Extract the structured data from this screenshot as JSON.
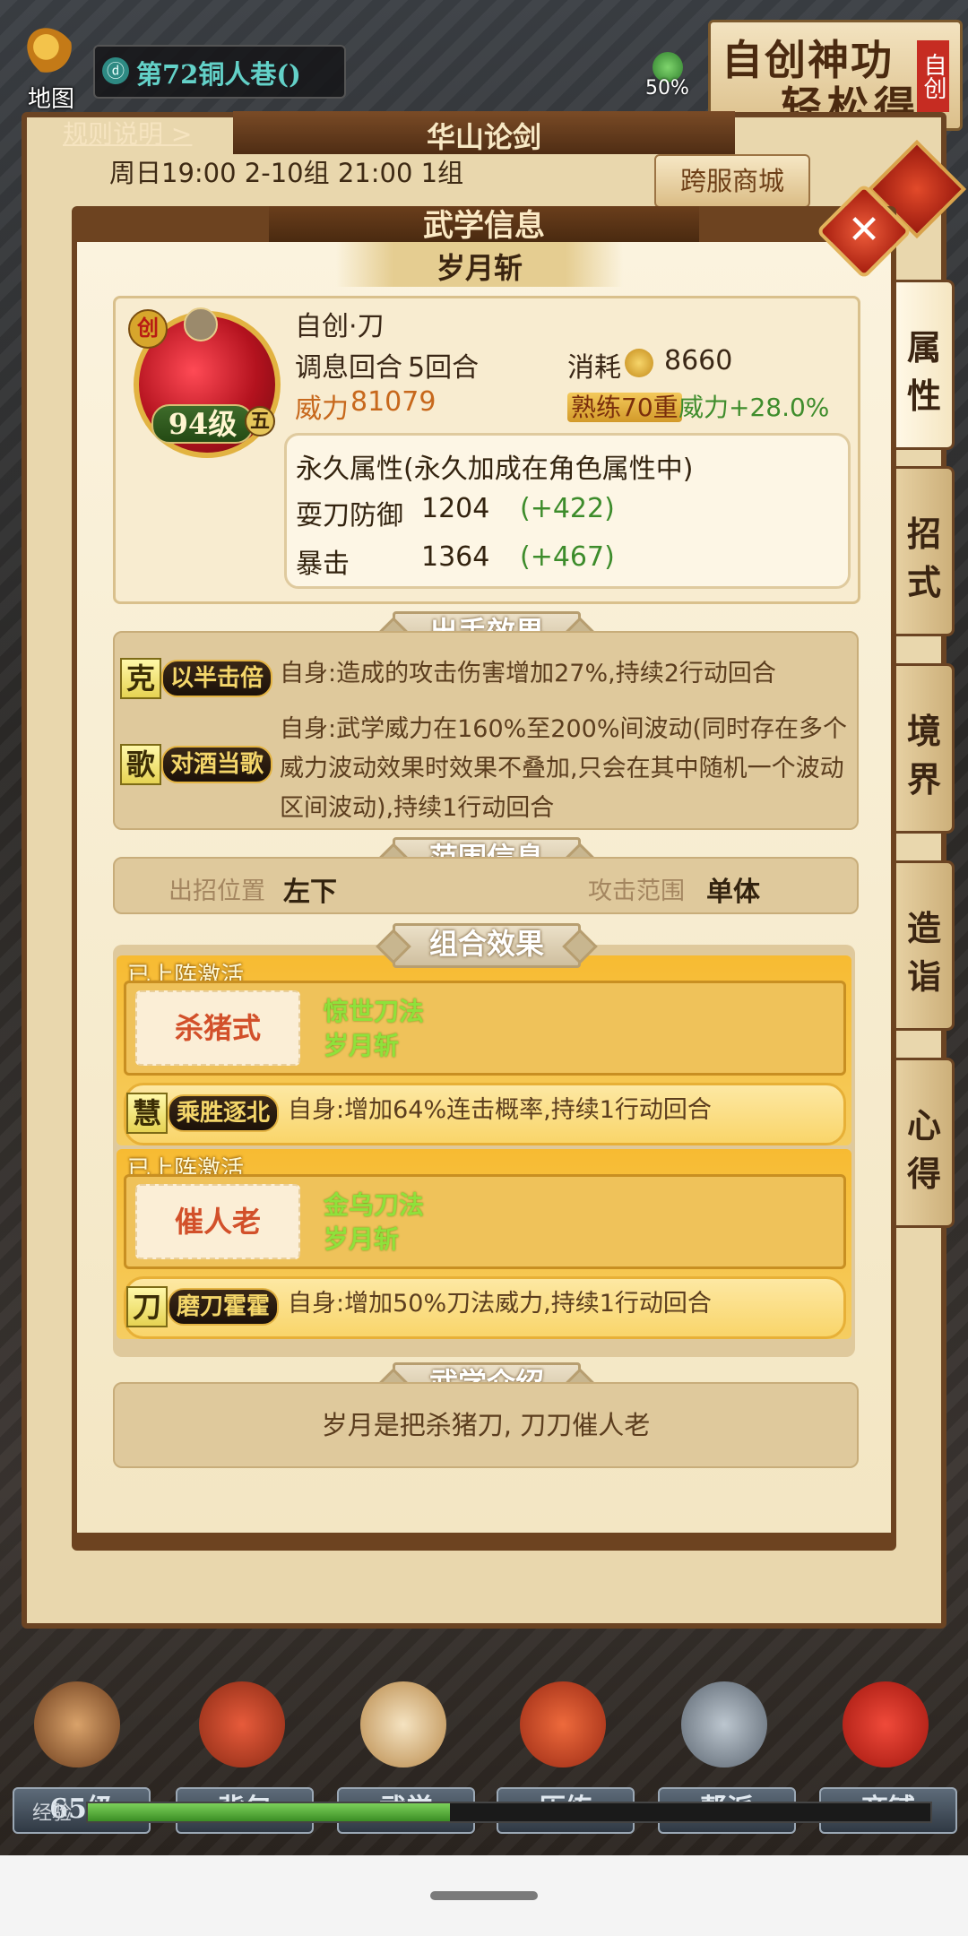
{
  "top_bar": {
    "map_label": "地图",
    "location_icon": "ⓓ",
    "location": "第72铜人巷()",
    "boost_percent": "50%",
    "promo_line1": "自创神功",
    "promo_line2": "轻松得",
    "promo_seal": "自创"
  },
  "background_panel": {
    "rules_link": "规则说明 >",
    "title": "华山论剑",
    "schedule": "周日19:00 2-10组 21:00 1组",
    "cross_shop": "跨服商城"
  },
  "modal": {
    "title": "武学信息",
    "close_label": "✕",
    "skill_name": "岁月斩",
    "tabs": [
      "属性",
      "招式",
      "境界",
      "造诣",
      "心得"
    ],
    "active_tab": 0,
    "info": {
      "create_badge": "创",
      "level": "94级",
      "tier": "五",
      "type": "自创·刀",
      "cooldown_label": "调息回合",
      "cooldown_value": "5回合",
      "cost_label": "消耗",
      "cost_value": "8660",
      "power_label": "威力",
      "power_value": "81079",
      "mastery": "熟练70重",
      "power_bonus": "威力+28.0%",
      "permanent_title": "永久属性(永久加成在角色属性中)",
      "permanent": [
        {
          "name": "耍刀防御",
          "value": "1204",
          "bonus": "(+422)"
        },
        {
          "name": "暴击",
          "value": "1364",
          "bonus": "(+467)"
        }
      ]
    },
    "sections": {
      "effects": "出手效果",
      "range": "范围信息",
      "combo": "组合效果",
      "intro": "武学介绍"
    },
    "effects": [
      {
        "icon": "克",
        "tag": "以半击倍",
        "text": "自身:造成的攻击伤害增加27%,持续2行动回合"
      },
      {
        "icon": "歌",
        "tag": "对酒当歌",
        "text": "自身:武学威力在160%至200%间波动(同时存在多个威力波动效果时效果不叠加,只会在其中随机一个波动区间波动),持续1行动回合"
      }
    ],
    "range": {
      "position_label": "出招位置",
      "position_value": "左下",
      "attack_label": "攻击范围",
      "attack_value": "单体"
    },
    "combos": [
      {
        "status": "已上阵激活",
        "name": "杀猪式",
        "skills": [
          "惊世刀法",
          "岁月斩"
        ],
        "effect_icon": "慧",
        "effect_tag": "乘胜逐北",
        "effect_text": "自身:增加64%连击概率,持续1行动回合"
      },
      {
        "status": "已上阵激活",
        "name": "催人老",
        "skills": [
          "金乌刀法",
          "岁月斩"
        ],
        "effect_icon": "刀",
        "effect_tag": "磨刀霍霍",
        "effect_text": "自身:增加50%刀法威力,持续1行动回合"
      }
    ],
    "intro": "岁月是把杀猪刀, 刀刀催人老"
  },
  "bottom_nav": {
    "items": [
      "65级",
      "背包",
      "武学",
      "历练",
      "帮派",
      "商铺"
    ],
    "exp_label": "经验",
    "exp_fraction": 0.43
  }
}
